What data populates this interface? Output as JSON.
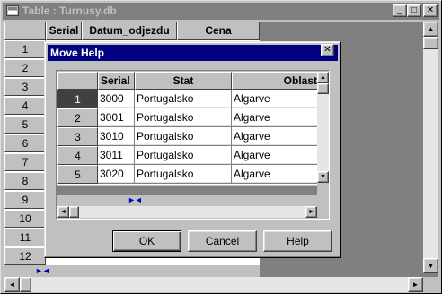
{
  "main_window": {
    "title": "Table : Turnusy.db",
    "controls": {
      "minimize": "_",
      "maximize": "□",
      "close": "✕"
    },
    "columns": [
      "Serial",
      "Datum_odjezdu",
      "Cena"
    ],
    "row_numbers": [
      "1",
      "2",
      "3",
      "4",
      "5",
      "6",
      "7",
      "8",
      "9",
      "10",
      "11",
      "12"
    ],
    "nav_arrows": "►◄"
  },
  "dialog": {
    "title": "Move Help",
    "close": "✕",
    "columns": [
      "Serial",
      "Stat",
      "Oblast"
    ],
    "rows": [
      {
        "num": "1",
        "serial": "3000",
        "stat": "Portugalsko",
        "oblast": "Algarve"
      },
      {
        "num": "2",
        "serial": "3001",
        "stat": "Portugalsko",
        "oblast": "Algarve"
      },
      {
        "num": "3",
        "serial": "3010",
        "stat": "Portugalsko",
        "oblast": "Algarve"
      },
      {
        "num": "4",
        "serial": "3011",
        "stat": "Portugalsko",
        "oblast": "Algarve"
      },
      {
        "num": "5",
        "serial": "3020",
        "stat": "Portugalsko",
        "oblast": "Algarve"
      }
    ],
    "nav_arrows": "►◄",
    "buttons": {
      "ok": "OK",
      "cancel": "Cancel",
      "help": "Help"
    }
  },
  "icons": {
    "scroll_up": "▲",
    "scroll_down": "▼",
    "scroll_left": "◄",
    "scroll_right": "►"
  },
  "colors": {
    "face": "#c0c0c0",
    "active_title": "#000080",
    "inactive_title": "#808080",
    "nav_arrow": "#0000c0"
  }
}
